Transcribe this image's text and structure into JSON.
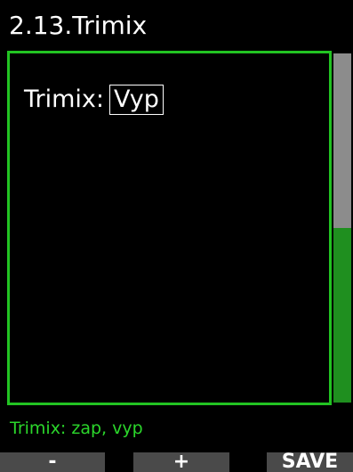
{
  "header": {
    "title": "2.13.Trimix"
  },
  "setting": {
    "label": "Trimix:",
    "value": "Vyp"
  },
  "scrollbar": {
    "thumb_fraction": 0.5,
    "colors": {
      "thumb": "#8c8c8c",
      "track": "#1f8f1f"
    }
  },
  "help": {
    "text": "Trimix: zap, vyp"
  },
  "softkeys": {
    "minus_label": "-",
    "plus_label": "+",
    "save_label": "SAVE"
  },
  "colors": {
    "accent": "#22c322",
    "help_text": "#2bd62b",
    "background": "#000000",
    "softkey_bg": "#4a4a4a"
  }
}
